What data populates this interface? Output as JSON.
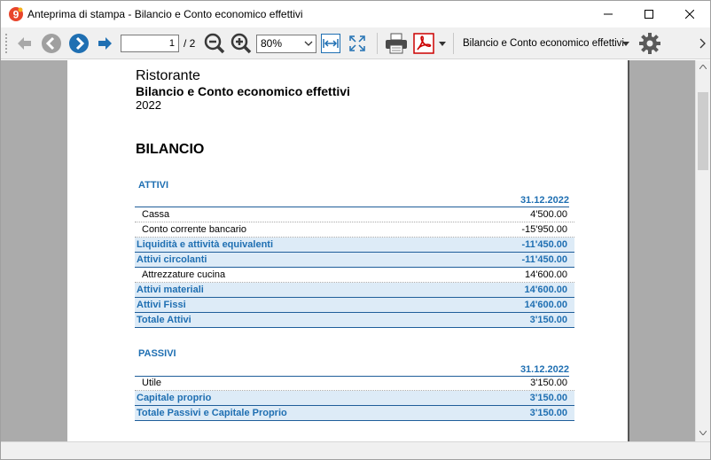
{
  "window": {
    "title": "Anteprima di stampa - Bilancio e Conto economico effettivi",
    "controls": [
      "minimize",
      "maximize",
      "close"
    ]
  },
  "toolbar": {
    "page_current": "1",
    "page_total": "/ 2",
    "zoom": "80%",
    "report_selector": "Bilancio e Conto economico effettivi",
    "icons": [
      "first-page-icon",
      "prev-page-icon",
      "next-page-icon",
      "last-page-icon",
      "zoom-out-icon",
      "zoom-in-icon",
      "fit-width-icon",
      "fit-page-icon",
      "print-icon",
      "pdf-icon",
      "dropdown-icon",
      "gear-icon"
    ]
  },
  "report": {
    "company": "Ristorante",
    "title": "Bilancio e Conto economico effettivi",
    "year": "2022",
    "section": "BILANCIO",
    "attivi": {
      "heading": "ATTIVI",
      "date_col": "31.12.2022",
      "rows": [
        {
          "label": "Cassa",
          "value": "4'500.00",
          "kind": "detail"
        },
        {
          "label": "Conto corrente bancario",
          "value": "-15'950.00",
          "kind": "detail"
        },
        {
          "label": "Liquidità e attività equivalenti",
          "value": "-11'450.00",
          "kind": "total"
        },
        {
          "label": "Attivi circolanti",
          "value": "-11'450.00",
          "kind": "total"
        },
        {
          "label": "Attrezzature cucina",
          "value": "14'600.00",
          "kind": "detail"
        },
        {
          "label": "Attivi materiali",
          "value": "14'600.00",
          "kind": "total"
        },
        {
          "label": "Attivi Fissi",
          "value": "14'600.00",
          "kind": "total"
        },
        {
          "label": "Totale Attivi",
          "value": "3'150.00",
          "kind": "total"
        }
      ]
    },
    "passivi": {
      "heading": "PASSIVI",
      "date_col": "31.12.2022",
      "rows": [
        {
          "label": "Utile",
          "value": "3'150.00",
          "kind": "detail"
        },
        {
          "label": "Capitale proprio",
          "value": "3'150.00",
          "kind": "total"
        },
        {
          "label": "Totale Passivi e Capitale Proprio",
          "value": "3'150.00",
          "kind": "total"
        }
      ]
    }
  },
  "colors": {
    "accent": "#1f6fb2",
    "total_row_bg": "#ddebf7",
    "viewport_bg": "#ababab",
    "nav_circle": "#1f6fb2"
  }
}
